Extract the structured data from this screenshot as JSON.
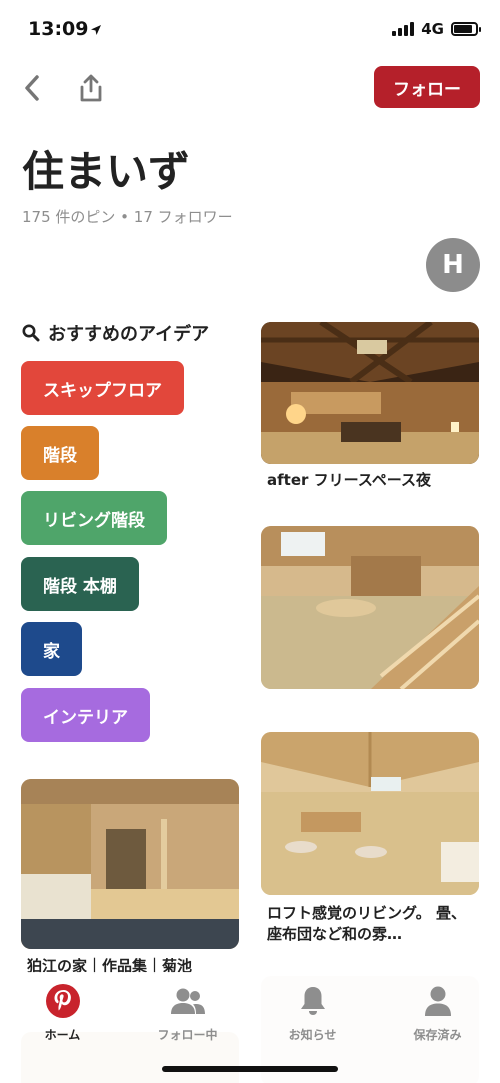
{
  "status": {
    "time": "13:09",
    "network": "4G",
    "battery_level": 0.85
  },
  "nav": {
    "follow_label": "フォロー"
  },
  "board": {
    "title": "住まいず",
    "stats": "175 件のピン • 17 フォロワー",
    "avatar_initial": "H"
  },
  "ideas": {
    "title": "おすすめのアイデア",
    "items": [
      {
        "label": "スキップフロア",
        "color": "#e2473b"
      },
      {
        "label": "階段",
        "color": "#d9802b"
      },
      {
        "label": "リビング階段",
        "color": "#4fa56a"
      },
      {
        "label": "階段 本棚",
        "color": "#2a6351"
      },
      {
        "label": "家",
        "color": "#1e4a8c"
      },
      {
        "label": "インテリア",
        "color": "#a66bdf"
      }
    ]
  },
  "pins": [
    {
      "caption": "after フリースペース夜"
    },
    {
      "caption": ""
    },
    {
      "caption": "ロフト感覚のリビング。 畳、座布団など和の雰…"
    },
    {
      "caption": "狛江の家｜作品集｜菊池"
    }
  ],
  "tabs": [
    {
      "label": "ホーム",
      "icon": "pinterest-icon",
      "active": true
    },
    {
      "label": "フォロー中",
      "icon": "people-icon",
      "active": false
    },
    {
      "label": "お知らせ",
      "icon": "bell-icon",
      "active": false
    },
    {
      "label": "保存済み",
      "icon": "person-icon",
      "active": false
    }
  ]
}
